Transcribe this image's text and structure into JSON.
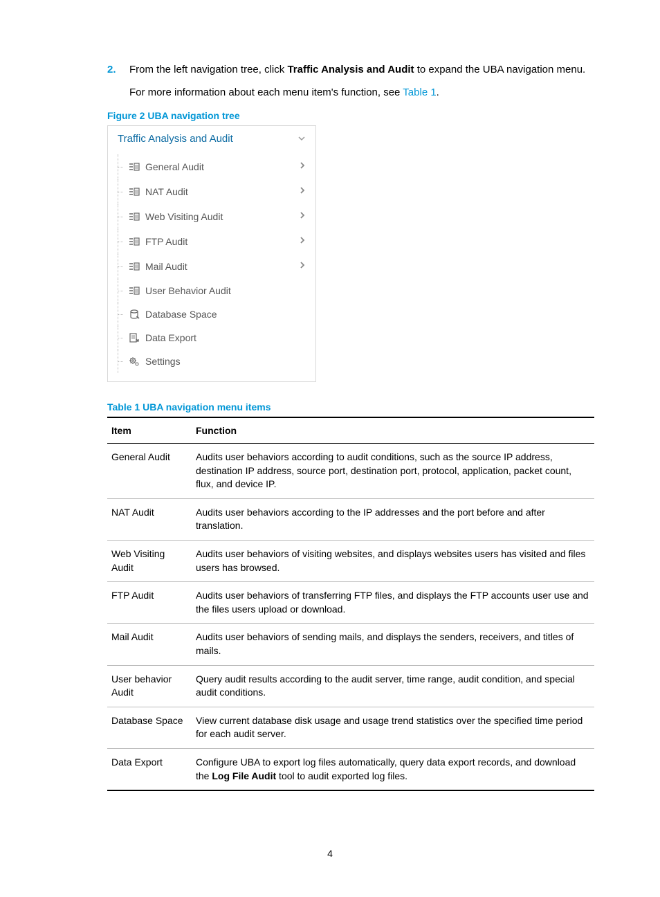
{
  "step": {
    "number": "2.",
    "text_prefix": "From the left navigation tree, click ",
    "text_bold": "Traffic Analysis and Audit",
    "text_suffix": " to expand the UBA navigation menu.",
    "subtext_prefix": "For more information about each menu item's function, see ",
    "subtext_link": "Table 1",
    "subtext_suffix": "."
  },
  "figure_caption": "Figure 2 UBA navigation tree",
  "navtree": {
    "header": "Traffic Analysis and Audit",
    "items": [
      {
        "label": "General Audit",
        "icon": "audit",
        "expandable": true
      },
      {
        "label": "NAT Audit",
        "icon": "audit",
        "expandable": true
      },
      {
        "label": "Web Visiting Audit",
        "icon": "audit",
        "expandable": true
      },
      {
        "label": "FTP Audit",
        "icon": "audit",
        "expandable": true
      },
      {
        "label": "Mail Audit",
        "icon": "audit",
        "expandable": true
      },
      {
        "label": "User Behavior Audit",
        "icon": "audit",
        "expandable": false
      },
      {
        "label": "Database Space",
        "icon": "db",
        "expandable": false
      },
      {
        "label": "Data Export",
        "icon": "export",
        "expandable": false
      },
      {
        "label": "Settings",
        "icon": "gear",
        "expandable": false
      }
    ]
  },
  "table_caption": "Table 1 UBA navigation menu items",
  "table": {
    "headers": [
      "Item",
      "Function"
    ],
    "rows": [
      {
        "item": "General Audit",
        "function_parts": [
          {
            "t": "Audits user behaviors according to audit conditions, such as the source IP address, destination IP address, source port, destination port, protocol, application, packet count, flux, and device IP."
          }
        ]
      },
      {
        "item": "NAT Audit",
        "function_parts": [
          {
            "t": "Audits user behaviors according to the IP addresses and the port before and after translation."
          }
        ]
      },
      {
        "item": "Web Visiting Audit",
        "function_parts": [
          {
            "t": "Audits user behaviors of visiting websites, and displays websites users has visited and files users has browsed."
          }
        ]
      },
      {
        "item": "FTP Audit",
        "function_parts": [
          {
            "t": "Audits user behaviors of transferring FTP files, and displays the FTP accounts user use and the files users upload or download."
          }
        ]
      },
      {
        "item": "Mail Audit",
        "function_parts": [
          {
            "t": "Audits user behaviors of sending mails, and displays the senders, receivers, and titles of mails."
          }
        ]
      },
      {
        "item": "User behavior Audit",
        "function_parts": [
          {
            "t": "Query audit results according to the audit server, time range, audit condition, and special audit conditions."
          }
        ]
      },
      {
        "item": "Database Space",
        "function_parts": [
          {
            "t": "View current database disk usage and usage trend statistics over the specified time period for each audit server."
          }
        ]
      },
      {
        "item": "Data Export",
        "function_parts": [
          {
            "t": "Configure UBA to export log files automatically, query data export records, and download the "
          },
          {
            "t": "Log File Audit",
            "b": true
          },
          {
            "t": " tool to audit exported log files."
          }
        ]
      }
    ]
  },
  "page_number": "4"
}
